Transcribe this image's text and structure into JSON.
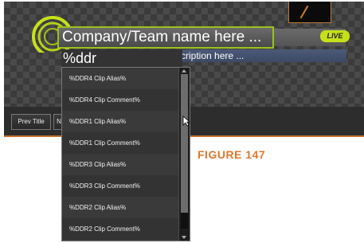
{
  "title_editor": {
    "name_field": "Company/Team name here ...",
    "description_field": "cription here ...",
    "live_badge": "LIVE",
    "typed_value": "%ddr"
  },
  "autocomplete": {
    "items": [
      "%DDR4 Clip Alias%",
      "%DDR4 Clip Comment%",
      "%DDR1 Clip Alias%",
      "%DDR1 Clip Comment%",
      "%DDR3 Clip Alias%",
      "%DDR3 Clip Comment%",
      "%DDR2 Clip Alias%",
      "%DDR2 Clip Comment%"
    ]
  },
  "toolbar": {
    "prev_title": "Prev Title",
    "next_title": "N"
  },
  "caption": "FIGURE 147",
  "colors": {
    "accent_green": "#9cc21a",
    "live_badge": "#c6e01a",
    "caption_orange": "#e0772c"
  }
}
